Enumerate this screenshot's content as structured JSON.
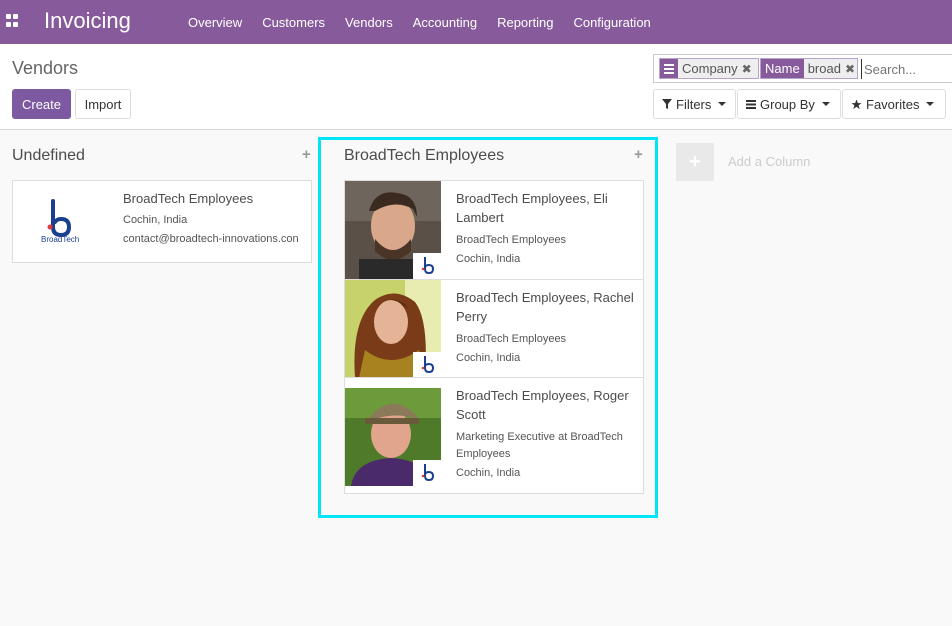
{
  "navbar": {
    "app_name": "Invoicing",
    "menu": [
      "Overview",
      "Customers",
      "Vendors",
      "Accounting",
      "Reporting",
      "Configuration"
    ]
  },
  "control": {
    "breadcrumb": "Vendors",
    "create_label": "Create",
    "import_label": "Import",
    "search": {
      "facets": [
        {
          "tag": "Company",
          "tag_icon": "group-by-icon",
          "value": ""
        },
        {
          "tag": "Name",
          "value": "broad"
        }
      ],
      "placeholder": "Search..."
    },
    "filters_label": "Filters",
    "groupby_label": "Group By",
    "favorites_label": "Favorites"
  },
  "columns": [
    {
      "title": "Undefined",
      "cards": [
        {
          "name": "BroadTech Employees",
          "line1": "Cochin, India",
          "line2": "contact@broadtech-innovations.con",
          "logo_text": "BroadTech"
        }
      ]
    },
    {
      "title": "BroadTech Employees",
      "cards": [
        {
          "name1": "BroadTech Employees, Eli",
          "name2": "Lambert",
          "line1": "BroadTech Employees",
          "line2": "Cochin, India"
        },
        {
          "name1": "BroadTech Employees, Rachel",
          "name2": "Perry",
          "line1": "BroadTech Employees",
          "line2": "Cochin, India"
        },
        {
          "name1": "BroadTech Employees, Roger",
          "name2": "Scott",
          "line1a": "Marketing Executive at BroadTech",
          "line1b": "Employees",
          "line2": "Cochin, India"
        }
      ]
    }
  ],
  "add_column_label": "Add a Column",
  "colors": {
    "brand": "#875a9b",
    "primary_button": "#7c59a0",
    "highlight": "#00e5f5"
  }
}
